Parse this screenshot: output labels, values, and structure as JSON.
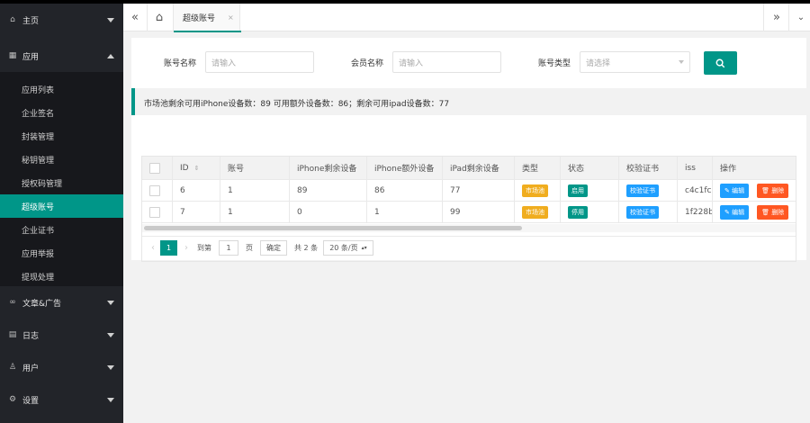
{
  "sidebar": {
    "groups": [
      {
        "label": "主页",
        "icon": "home-icon"
      },
      {
        "label": "应用",
        "icon": "apps-icon"
      },
      {
        "label": "文章&广告",
        "icon": "link-icon"
      },
      {
        "label": "日志",
        "icon": "log-icon"
      },
      {
        "label": "用户",
        "icon": "user-icon"
      },
      {
        "label": "设置",
        "icon": "gear-icon"
      }
    ],
    "items": [
      "应用列表",
      "企业签名",
      "封装管理",
      "秘钥管理",
      "授权码管理",
      "超级账号",
      "企业证书",
      "应用举报",
      "提现处理"
    ],
    "active_item": "超级账号"
  },
  "topbar": {
    "tab_label": "超级账号",
    "tab_close": "×"
  },
  "filters": {
    "account_label": "账号名称",
    "account_placeholder": "请输入",
    "member_label": "会员名称",
    "member_placeholder": "请输入",
    "type_label": "账号类型",
    "type_placeholder": "请选择"
  },
  "notice": "市场池剩余可用iPhone设备数：89 可用额外设备数：86；剩余可用ipad设备数：77",
  "table": {
    "headers": [
      "ID",
      "账号",
      "iPhone剩余设备",
      "iPhone额外设备",
      "iPad剩余设备",
      "类型",
      "状态",
      "校验证书",
      "iss",
      "操作"
    ],
    "rows": [
      {
        "id": "6",
        "account": "1",
        "iphone_left": "89",
        "iphone_extra": "86",
        "ipad_left": "77",
        "type": "市场池",
        "status": "启用",
        "cert": "校验证书",
        "iss": "c4c1fca",
        "edit": "编辑",
        "delete": "删除"
      },
      {
        "id": "7",
        "account": "1",
        "iphone_left": "0",
        "iphone_extra": "1",
        "ipad_left": "99",
        "type": "市场池",
        "status": "停用",
        "cert": "校验证书",
        "iss": "1f228bc",
        "edit": "编辑",
        "delete": "删除"
      }
    ]
  },
  "pager": {
    "current": "1",
    "goto_label": "到第",
    "goto_value": "1",
    "page_unit": "页",
    "confirm": "确定",
    "total": "共 2 条",
    "page_size": "20 条/页"
  },
  "colors": {
    "accent": "#009688",
    "sidebar": "#222429",
    "yellow": "#f0ad1f",
    "blue": "#1e9fff",
    "red": "#ff5722"
  }
}
